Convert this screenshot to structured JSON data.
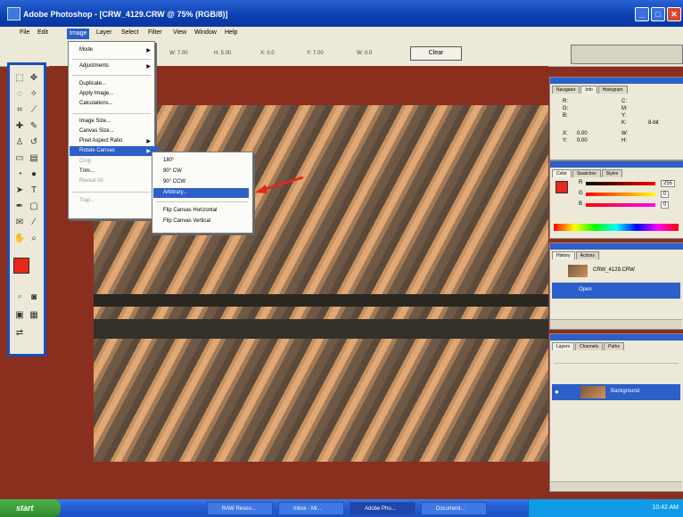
{
  "window": {
    "title": "Adobe Photoshop - [CRW_4129.CRW @ 75% (RGB/8)]",
    "controls": [
      "_",
      "□",
      "✕"
    ]
  },
  "menubar": {
    "items": [
      "File",
      "Edit",
      "Image",
      "Layer",
      "Select",
      "Filter",
      "View",
      "Window",
      "Help"
    ],
    "active": "Image"
  },
  "options_bar": {
    "fields": [
      "W: 7.00",
      "H: 5.00",
      "X: 0.0",
      "Y: 7.00",
      "W: 0.0"
    ],
    "clear_label": "Clear"
  },
  "image_menu": {
    "items": [
      {
        "label": "Mode",
        "arrow": true
      },
      {
        "label": "Adjustments",
        "arrow": true
      },
      {
        "label": "Duplicate..."
      },
      {
        "label": "Apply Image..."
      },
      {
        "label": "Calculations..."
      },
      {
        "label": "Image Size..."
      },
      {
        "label": "Canvas Size..."
      },
      {
        "label": "Pixel Aspect Ratio",
        "arrow": true
      },
      {
        "label": "Rotate Canvas",
        "arrow": true,
        "selected": true
      },
      {
        "label": "Crop",
        "disabled": true
      },
      {
        "label": "Trim..."
      },
      {
        "label": "Reveal All",
        "disabled": true
      },
      {
        "label": "Trap...",
        "disabled": true
      }
    ]
  },
  "rotate_menu": {
    "items": [
      {
        "label": "180°"
      },
      {
        "label": "90° CW"
      },
      {
        "label": "90° CCW"
      },
      {
        "label": "Arbitrary...",
        "selected": true
      },
      {
        "label": "Flip Canvas Horizontal"
      },
      {
        "label": "Flip Canvas Vertical"
      }
    ]
  },
  "panels": {
    "navigator": {
      "tabs": [
        "Navigator",
        "Info",
        "Histogram"
      ],
      "values": [
        "R:",
        "G:",
        "B:",
        "X:",
        "Y:",
        "C:",
        "M:",
        "Y:",
        "K:",
        "8-bit",
        "0.00",
        "0.00",
        "W:",
        "H:"
      ]
    },
    "color": {
      "tabs": [
        "Color",
        "Swatches",
        "Styles"
      ],
      "channels": [
        {
          "label": "R",
          "value": "255"
        },
        {
          "label": "G",
          "value": "0"
        },
        {
          "label": "B",
          "value": "0"
        }
      ]
    },
    "history": {
      "tabs": [
        "History",
        "Actions"
      ],
      "items": [
        "CRW_4129.CRW",
        "Open"
      ]
    },
    "layers": {
      "tabs": [
        "Layers",
        "Channels",
        "Paths"
      ],
      "items": [
        "Background"
      ]
    }
  },
  "colors": {
    "canvas_bg": "#8a2e1e",
    "accent": "#2c5fc7",
    "foreground": "#e8281a",
    "background": "#1f8a2a"
  },
  "taskbar": {
    "start_label": "start",
    "items": [
      {
        "label": "RAW Resou...",
        "active": false
      },
      {
        "label": "Inbox - Mi...",
        "active": false
      },
      {
        "label": "Adobe Pho...",
        "active": true
      },
      {
        "label": "Document...",
        "active": false
      }
    ],
    "clock": "10:42 AM"
  }
}
